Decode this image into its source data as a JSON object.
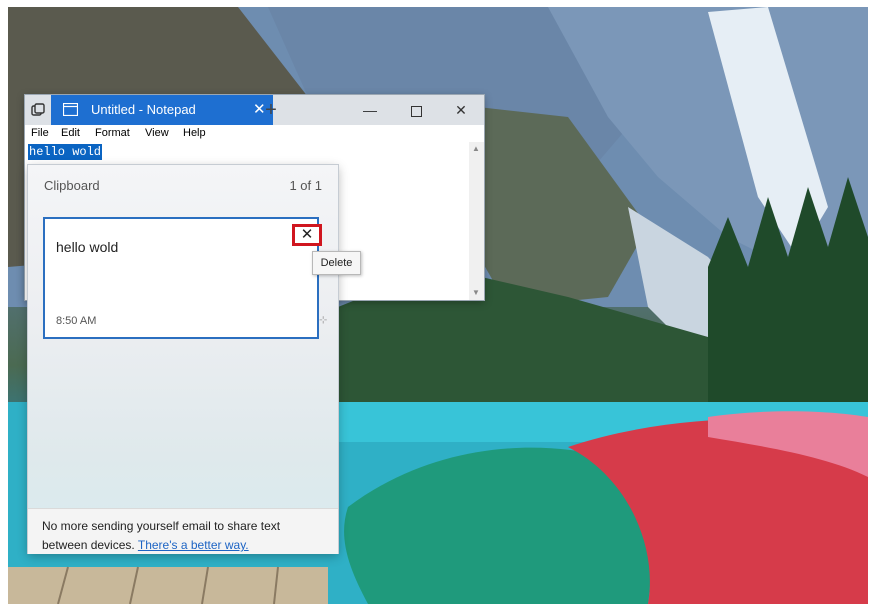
{
  "notepad": {
    "tab_title": "Untitled - Notepad",
    "tab_close": "✕",
    "new_tab": "+",
    "controls": {
      "minimize": "—",
      "close": "✕"
    },
    "menu": [
      "File",
      "Edit",
      "Format",
      "View",
      "Help"
    ],
    "content": "hello wold",
    "accent": "#1e6fd1"
  },
  "clipboard": {
    "title": "Clipboard",
    "count": "1 of 1",
    "item": {
      "text": "hello wold",
      "time": "8:50 AM"
    },
    "delete_glyph": "✕",
    "tooltip": "Delete",
    "footer_text": "No more sending yourself email to share text between devices.",
    "footer_link": "There's a better way.",
    "highlight_color": "#d0161f"
  }
}
